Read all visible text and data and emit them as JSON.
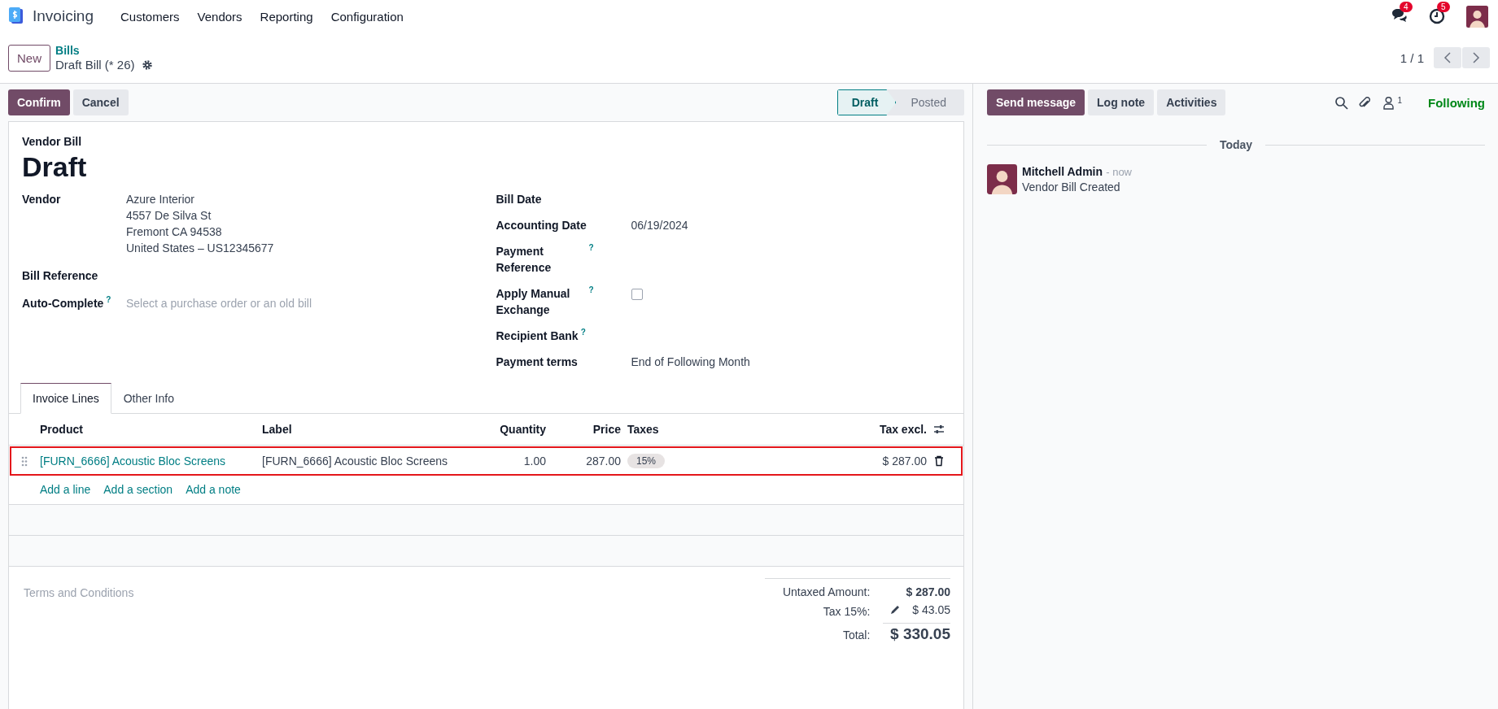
{
  "navbar": {
    "app_name": "Invoicing",
    "menus": [
      "Customers",
      "Vendors",
      "Reporting",
      "Configuration"
    ],
    "messages_count": "4",
    "activities_count": "5"
  },
  "breadcrumb": {
    "new_button": "New",
    "parent": "Bills",
    "current": "Draft Bill (* 26)",
    "pager": "1 / 1"
  },
  "actions": [
    {
      "label": "Confirm",
      "kind": "primary"
    },
    {
      "label": "Cancel",
      "kind": "secondary"
    }
  ],
  "statusbar": [
    {
      "label": "Draft",
      "selected": true
    },
    {
      "label": "Posted",
      "selected": false
    }
  ],
  "form": {
    "subtitle": "Vendor Bill",
    "title": "Draft",
    "left_fields": [
      {
        "label": "Vendor",
        "kind": "text",
        "values": [
          "Azure Interior",
          "4557 De Silva St",
          "Fremont CA 94538",
          "United States – US12345677"
        ]
      },
      {
        "label": "Bill Reference",
        "kind": "text"
      },
      {
        "label": "Auto-Complete",
        "help": "?",
        "kind": "text",
        "placeholder": "Select a purchase order or an old bill"
      }
    ],
    "right_fields": [
      {
        "label": "Bill Date",
        "kind": "text"
      },
      {
        "label": "Accounting Date",
        "kind": "text",
        "values": [
          "06/19/2024"
        ]
      },
      {
        "label": "Payment Reference",
        "help": "?",
        "kind": "text"
      },
      {
        "label": "Apply Manual Exchange",
        "help": "?",
        "kind": "checkbox",
        "checked": false
      },
      {
        "label": "Recipient Bank",
        "help": "?",
        "kind": "text"
      },
      {
        "label": "Payment terms",
        "kind": "text",
        "values": [
          "End of Following Month"
        ]
      }
    ]
  },
  "tabs": [
    {
      "label": "Invoice Lines",
      "selected": true
    },
    {
      "label": "Other Info",
      "selected": false
    }
  ],
  "table": {
    "columns": [
      "Product",
      "Label",
      "Quantity",
      "Price",
      "Taxes",
      "Tax excl."
    ],
    "rows": [
      {
        "product": "[FURN_6666] Acoustic Bloc Screens",
        "label": "[FURN_6666] Acoustic Bloc Screens",
        "quantity": "1.00",
        "price": "287.00",
        "taxes": [
          "15%"
        ],
        "tax_excl": "$ 287.00",
        "highlighted": true
      }
    ],
    "add_links": [
      "Add a line",
      "Add a section",
      "Add a note"
    ]
  },
  "terms_placeholder": "Terms and Conditions",
  "totals": [
    {
      "label": "Untaxed Amount:",
      "value": "$ 287.00",
      "kind": "subtotal"
    },
    {
      "label": "Tax 15%:",
      "value": "$ 43.05",
      "kind": "tax"
    },
    {
      "label": "Total:",
      "value": "$ 330.05",
      "kind": "total"
    }
  ],
  "chatter": {
    "buttons": [
      {
        "label": "Send message",
        "kind": "primary"
      },
      {
        "label": "Log note",
        "kind": "secondary"
      },
      {
        "label": "Activities",
        "kind": "secondary"
      }
    ],
    "followers_count": "1",
    "follow_label": "Following",
    "date_separator": "Today",
    "messages": [
      {
        "author": "Mitchell Admin",
        "time": "- now",
        "body": "Vendor Bill Created"
      }
    ]
  }
}
